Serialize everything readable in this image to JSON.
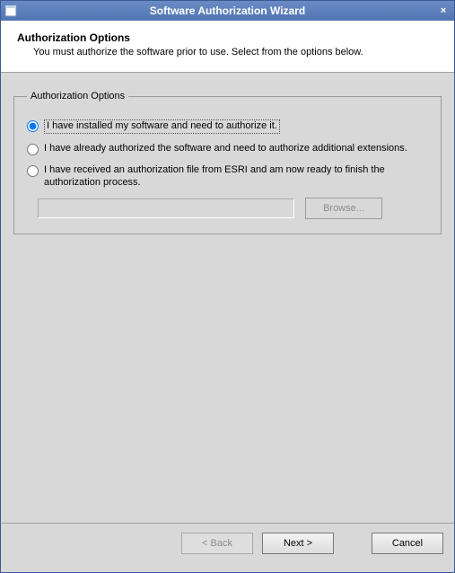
{
  "titlebar": {
    "title": "Software Authorization Wizard",
    "appicon": "window-icon",
    "close_label": "×"
  },
  "header": {
    "title": "Authorization Options",
    "subtitle": "You must authorize the software prior to use. Select from the options below."
  },
  "group": {
    "legend": "Authorization Options",
    "options": [
      {
        "label": "I have installed my software and need to authorize it.",
        "selected": true
      },
      {
        "label": "I have already authorized the software and need to authorize additional extensions.",
        "selected": false
      },
      {
        "label": "I have received an authorization file from ESRI and am now ready to finish the authorization process.",
        "selected": false
      }
    ],
    "file_value": "",
    "browse_label": "Browse...",
    "browse_enabled": false,
    "file_enabled": false
  },
  "footer": {
    "back_label": "< Back",
    "back_enabled": false,
    "next_label": "Next >",
    "next_enabled": true,
    "cancel_label": "Cancel",
    "cancel_enabled": true
  }
}
